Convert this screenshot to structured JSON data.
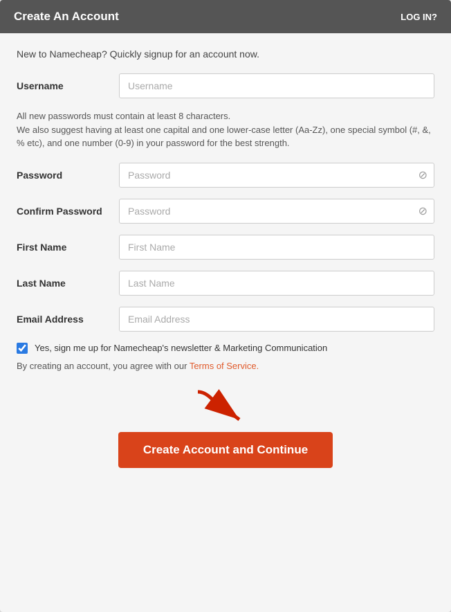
{
  "header": {
    "title": "Create An Account",
    "login_label": "LOG IN?"
  },
  "intro": {
    "text": "New to Namecheap? Quickly signup for an account now."
  },
  "password_hint": {
    "text": "All new passwords must contain at least 8 characters.\nWe also suggest having at least one capital and one lower-case letter (Aa-Zz), one special symbol (#, &, % etc), and one number (0-9) in your password for the best strength."
  },
  "form": {
    "username_label": "Username",
    "username_placeholder": "Username",
    "password_label": "Password",
    "password_placeholder": "Password",
    "confirm_password_label": "Confirm Password",
    "confirm_password_placeholder": "Password",
    "first_name_label": "First Name",
    "first_name_placeholder": "First Name",
    "last_name_label": "Last Name",
    "last_name_placeholder": "Last Name",
    "email_label": "Email Address",
    "email_placeholder": "Email Address"
  },
  "newsletter": {
    "label": "Yes, sign me up for Namecheap's newsletter & Marketing Communication"
  },
  "terms": {
    "text": "By creating an account, you agree with our ",
    "link_text": "Terms of Service."
  },
  "submit": {
    "label": "Create Account and Continue"
  }
}
